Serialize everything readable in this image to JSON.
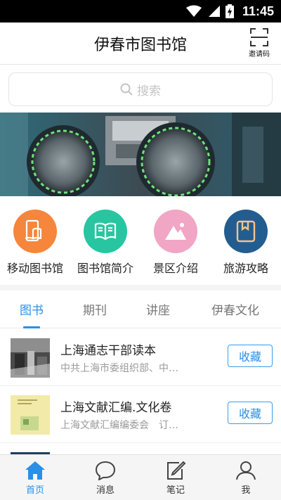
{
  "status_bar": {
    "time": "11:45"
  },
  "header": {
    "title": "伊春市图书馆",
    "invite_label": "邀请码"
  },
  "search": {
    "placeholder": "搜索"
  },
  "quick_menu": [
    {
      "label": "移动图书馆",
      "color": "#f5863b",
      "icon": "mobile-book-icon"
    },
    {
      "label": "图书馆简介",
      "color": "#27c6a0",
      "icon": "open-book-icon"
    },
    {
      "label": "景区介绍",
      "color": "#f0a6c4",
      "icon": "mountain-icon"
    },
    {
      "label": "旅游攻略",
      "color": "#235d8f",
      "icon": "bookmark-book-icon"
    }
  ],
  "tabs": [
    {
      "label": "图书",
      "active": true
    },
    {
      "label": "期刊",
      "active": false
    },
    {
      "label": "讲座",
      "active": false
    },
    {
      "label": "伊春文化",
      "active": false
    }
  ],
  "books": [
    {
      "title": "上海通志干部读本",
      "author": "中共上海市委组织部、中…",
      "action": "收藏"
    },
    {
      "title": "上海文献汇编.文化卷",
      "author": "上海文献汇编编委会　订…",
      "action": "收藏"
    }
  ],
  "bottom_nav": [
    {
      "label": "首页",
      "icon": "home-icon",
      "active": true
    },
    {
      "label": "消息",
      "icon": "message-icon",
      "active": false
    },
    {
      "label": "笔记",
      "icon": "note-icon",
      "active": false
    },
    {
      "label": "我",
      "icon": "profile-icon",
      "active": false
    }
  ],
  "colors": {
    "accent": "#2a8fe6"
  }
}
